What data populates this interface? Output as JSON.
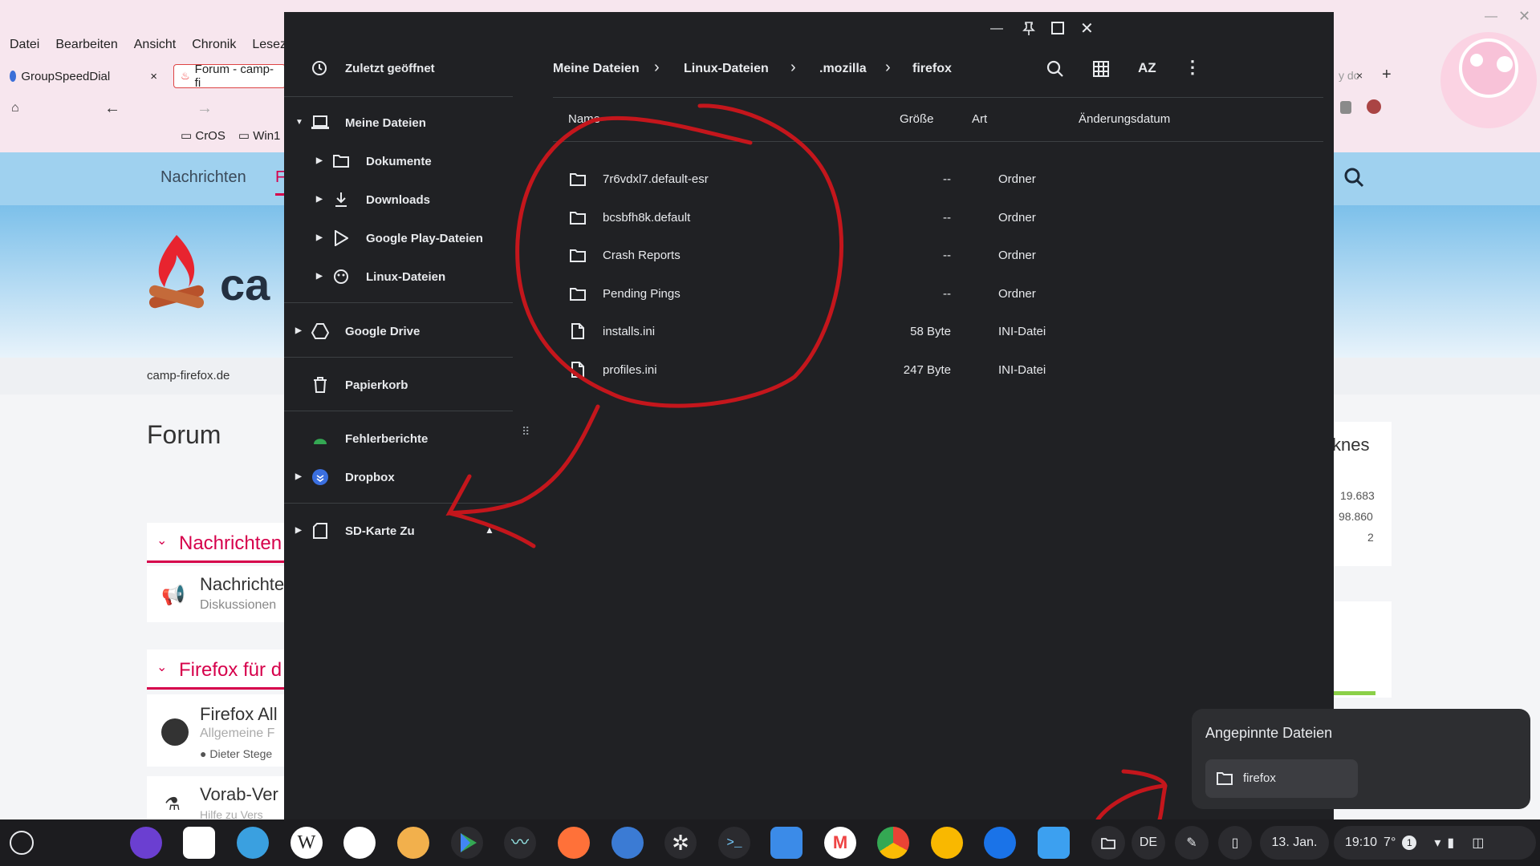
{
  "browser": {
    "menu": [
      "Datei",
      "Bearbeiten",
      "Ansicht",
      "Chronik",
      "Lesez"
    ],
    "tabs": [
      {
        "label": "GroupSpeedDial",
        "close": "×"
      },
      {
        "label": "Forum - camp-fi"
      }
    ],
    "bookmarks": [
      "CrOS",
      "Win1"
    ],
    "right_tab_fragment": "y dc",
    "right_tab_close": "×",
    "new_tab": "+"
  },
  "website": {
    "nav_items": [
      "Nachrichten",
      "F"
    ],
    "logo_text": "ca",
    "breadcrumb": "camp-firefox.de",
    "page_title": "Forum",
    "categories": [
      "Nachrichten",
      "Firefox für d"
    ],
    "boards": [
      {
        "title": "Nachrichte",
        "subtitle": "Diskussionen"
      },
      {
        "title": "Firefox All",
        "subtitle": "Allgemeine F",
        "author": "Dieter Stege"
      },
      {
        "title": "Vorab-Ver",
        "subtitle": "Hilfe zu Vers"
      }
    ],
    "stats_title_fragment": "knes",
    "stats": [
      "19.683",
      "98.860",
      "2"
    ]
  },
  "files": {
    "recent": "Zuletzt geöffnet",
    "my_files": "Meine Dateien",
    "sub_items": [
      "Dokumente",
      "Downloads",
      "Google Play-Dateien",
      "Linux-Dateien"
    ],
    "google_drive": "Google Drive",
    "trash": "Papierkorb",
    "error_reports": "Fehlerberichte",
    "dropbox": "Dropbox",
    "sd_card": "SD-Karte Zu",
    "breadcrumb": [
      "Meine Dateien",
      "Linux-Dateien",
      ".mozilla",
      "firefox"
    ],
    "sort_label": "AZ",
    "columns": {
      "name": "Name",
      "size": "Größe",
      "type": "Art",
      "modified": "Änderungsdatum"
    },
    "rows": [
      {
        "name": "7r6vdxl7.default-esr",
        "size": "--",
        "type": "Ordner",
        "kind": "folder"
      },
      {
        "name": "bcsbfh8k.default",
        "size": "--",
        "type": "Ordner",
        "kind": "folder"
      },
      {
        "name": "Crash Reports",
        "size": "--",
        "type": "Ordner",
        "kind": "folder"
      },
      {
        "name": "Pending Pings",
        "size": "--",
        "type": "Ordner",
        "kind": "folder"
      },
      {
        "name": "installs.ini",
        "size": "58 Byte",
        "type": "INI-Datei",
        "kind": "file"
      },
      {
        "name": "profiles.ini",
        "size": "247 Byte",
        "type": "INI-Datei",
        "kind": "file"
      }
    ]
  },
  "pinned": {
    "title": "Angepinnte Dateien",
    "item": "firefox"
  },
  "shelf": {
    "ime": "DE",
    "date": "13. Jan.",
    "time": "19:10",
    "temp": "7°",
    "notif_count": "1"
  },
  "colors": {
    "annotation": "#c4161c",
    "files_bg": "#202124",
    "accent": "#d6004b"
  }
}
